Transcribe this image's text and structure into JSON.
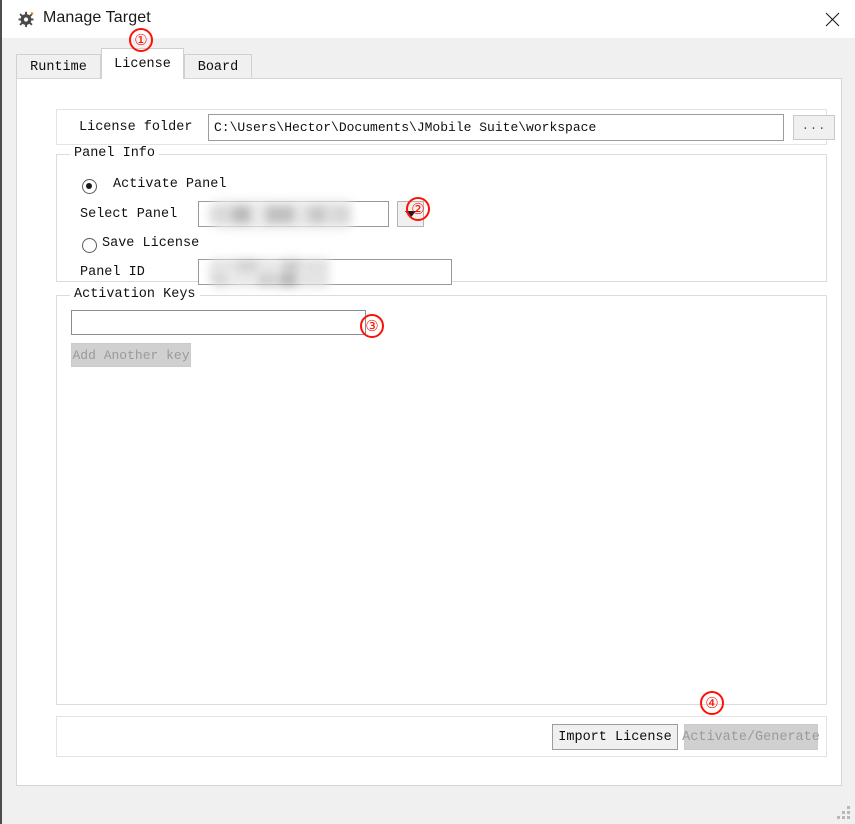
{
  "window": {
    "title": "Manage Target",
    "icon": "gear-icon",
    "close_label": "×"
  },
  "tabs": [
    {
      "label": "Runtime",
      "active": false
    },
    {
      "label": "License",
      "active": true
    },
    {
      "label": "Board",
      "active": false
    }
  ],
  "license_tab": {
    "folder": {
      "label": "License folder",
      "value": "C:\\Users\\Hector\\Documents\\JMobile Suite\\workspace",
      "browse_label": "..."
    },
    "panel_info": {
      "title": "Panel Info",
      "activate_panel": {
        "label": "Activate Panel",
        "selected": true
      },
      "select_panel": {
        "label": "Select Panel",
        "value": "",
        "redacted": true
      },
      "save_license": {
        "label": "Save License",
        "selected": false
      },
      "panel_id": {
        "label": "Panel ID",
        "value": "",
        "redacted": true
      }
    },
    "activation_keys": {
      "title": "Activation Keys",
      "key_value": "",
      "key_placeholder": "",
      "add_another_label": "Add Another key",
      "add_another_enabled": false
    },
    "footer": {
      "import_label": "Import License",
      "import_enabled": true,
      "activate_label": "Activate/Generate",
      "activate_enabled": false
    }
  },
  "annotations": [
    {
      "id": "1",
      "text": "①",
      "target": "tab-license"
    },
    {
      "id": "2",
      "text": "②",
      "target": "select-panel-dropdown"
    },
    {
      "id": "3",
      "text": "③",
      "target": "activation-key-input"
    },
    {
      "id": "4",
      "text": "④",
      "target": "activate-generate-button"
    }
  ],
  "colors": {
    "annotation_red": "#fc1206",
    "titlebar_bg": "#ffffff",
    "dialog_bg": "#f0f0f0",
    "content_bg": "#ffffff",
    "disabled_button_bg": "#d0d0d0",
    "disabled_text": "#9a9a9a"
  }
}
